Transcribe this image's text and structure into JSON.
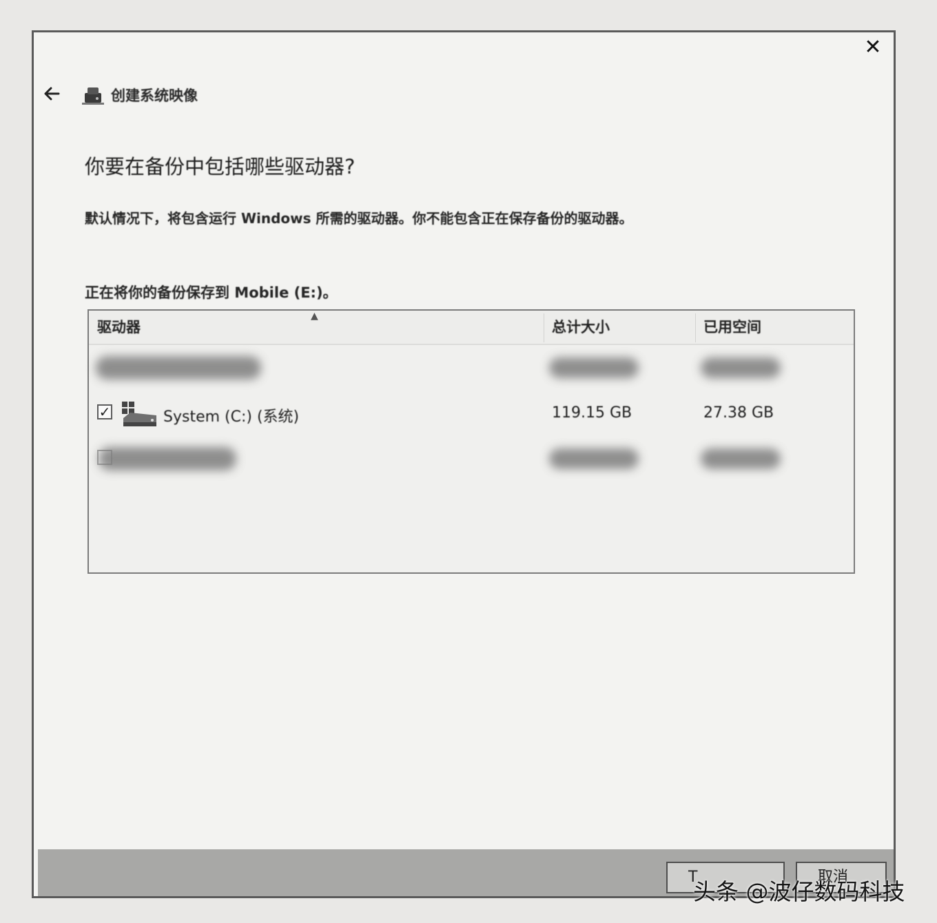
{
  "window": {
    "title": "创建系统映像",
    "close_label": "✕"
  },
  "heading": "你要在备份中包括哪些驱动器?",
  "description": "默认情况下，将包含运行 Windows 所需的驱动器。你不能包含正在保存备份的驱动器。",
  "save_location": "正在将你的备份保存到 Mobile (E:)。",
  "table": {
    "columns": {
      "drive": "驱动器",
      "total_size": "总计大小",
      "used_space": "已用空间"
    },
    "rows": [
      {
        "name": "",
        "total": "",
        "used": "",
        "checked": false,
        "redacted": true
      },
      {
        "name": "System (C:) (系统)",
        "total": "119.15 GB",
        "used": "27.38 GB",
        "checked": true,
        "redacted": false
      },
      {
        "name": "",
        "total": "",
        "used": "",
        "checked": false,
        "redacted": true
      }
    ]
  },
  "footer": {
    "next_label": "T",
    "cancel_label": "取消"
  },
  "watermark": "头条 @波仔数码科技",
  "icons": {
    "back": "arrow-left-icon",
    "title": "system-image-icon",
    "drive": "hard-drive-icon",
    "close": "close-icon"
  }
}
